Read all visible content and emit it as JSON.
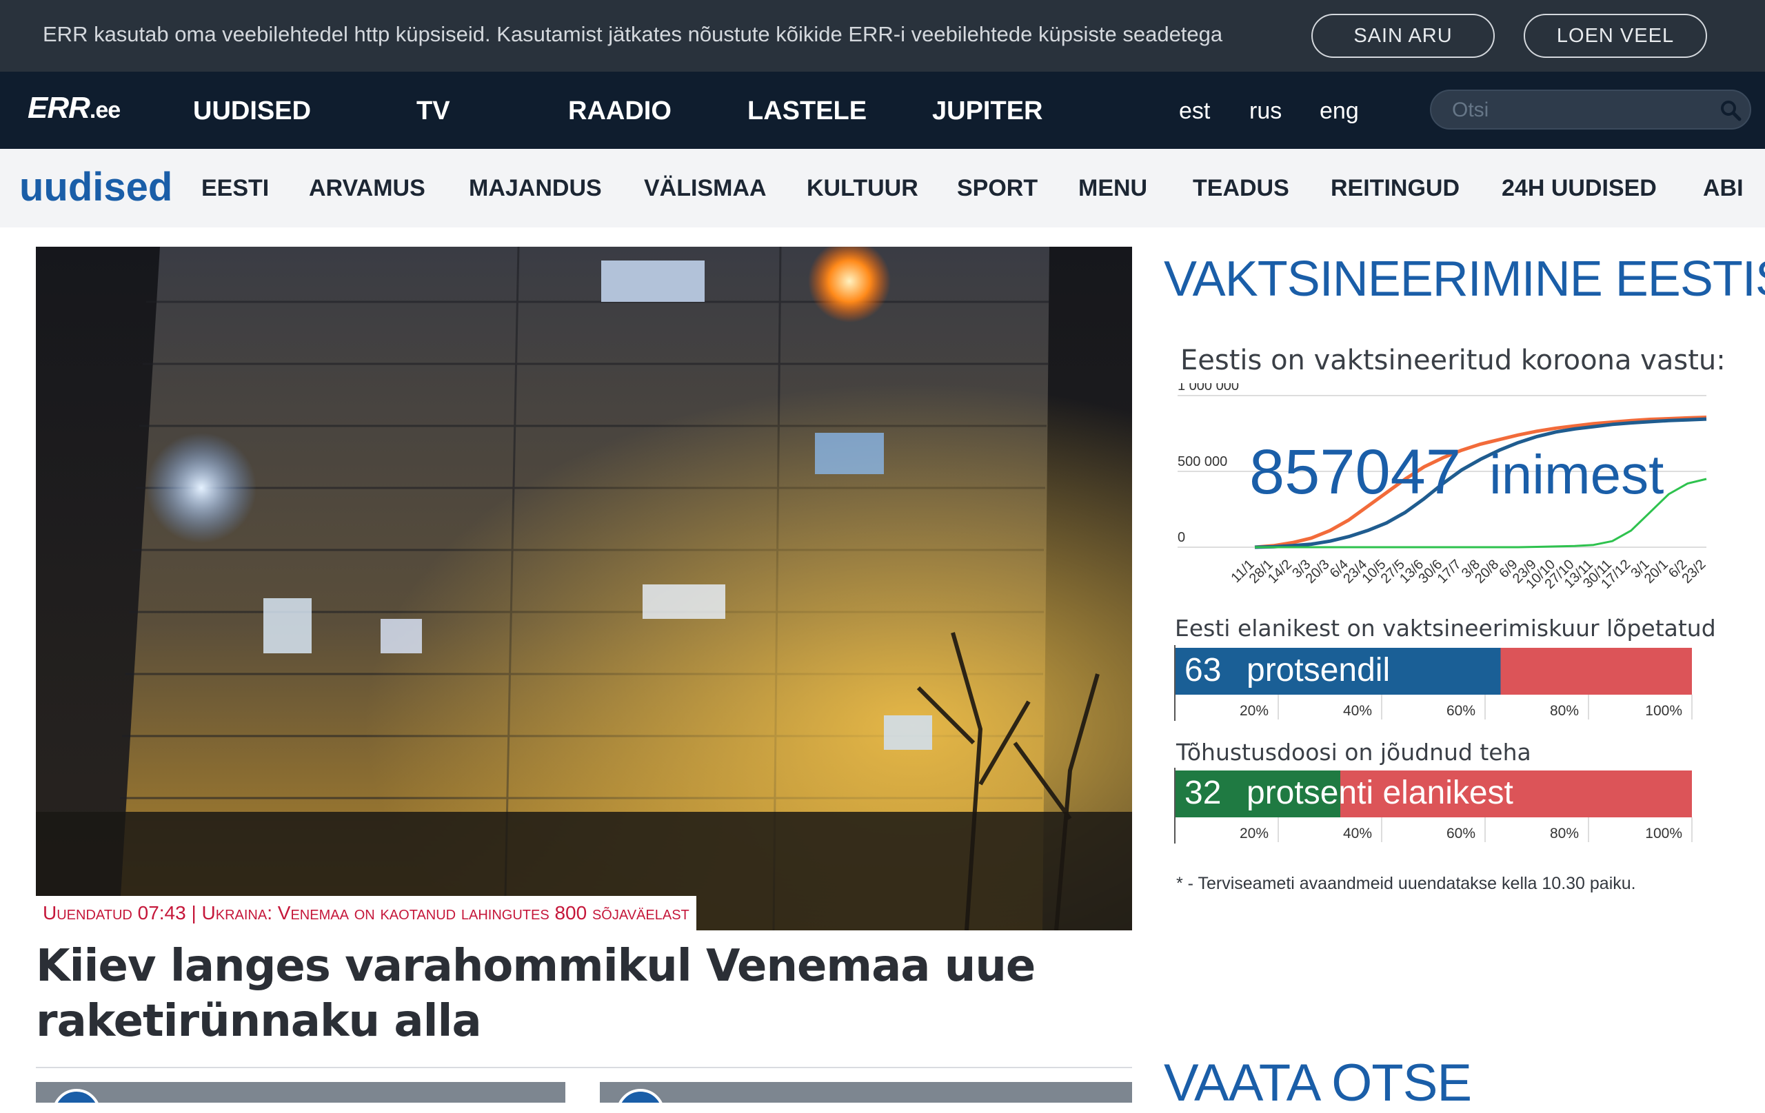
{
  "cookie": {
    "message": "ERR kasutab oma veebilehtedel http küpsiseid. Kasutamist jätkates nõustute kõikide ERR-i veebilehtede küpsiste seadetega",
    "accept_label": "SAIN ARU",
    "more_label": "LOEN VEEL"
  },
  "topnav": {
    "logo": "ERR",
    "logo_suffix": ".ee",
    "items": [
      "UUDISED",
      "TV",
      "RAADIO",
      "LASTELE",
      "JUPITER"
    ],
    "languages": [
      "est",
      "rus",
      "eng"
    ],
    "search_placeholder": "Otsi"
  },
  "subnav": {
    "brand": "uudised",
    "items": [
      "EESTI",
      "ARVAMUS",
      "MAJANDUS",
      "VÄLISMAA",
      "KULTUUR",
      "SPORT",
      "MENU",
      "TEADUS",
      "REITINGUD",
      "24H UUDISED",
      "ABI"
    ]
  },
  "hero": {
    "tag": "Uuendatud 07:43 | Ukraina: Venemaa on kaotanud lahingutes 800 sõjaväelast",
    "headline": "Kiiev langes varahommikul Venemaa uue raketirünnaku alla"
  },
  "sidebar": {
    "title": "VAKTSINEERIMINE EESTIS",
    "subtitle": "Eestis on vaktsineeritud koroona vastu:",
    "big_number": "857047",
    "big_unit": "inimest",
    "bar1_label": "Eesti elanikest on vaktsineerimiskuur lõpetatud",
    "bar1_value": "63",
    "bar1_unit": "protsendil",
    "bar2_label": "Tõhustusdoosi on jõudnud teha",
    "bar2_value": "32",
    "bar2_unit": "protsenti elanikest",
    "footnote": "* - Terviseameti avaandmeid uuendatakse kella 10.30 paiku.",
    "watch_title": "VAATA OTSE"
  },
  "chart_data": [
    {
      "type": "line",
      "ytick_labels": [
        "1 000 000",
        "500 000",
        "0"
      ],
      "ylim": [
        0,
        1000000
      ],
      "x_labels": [
        "11/1",
        "28/1",
        "14/2",
        "3/3",
        "20/3",
        "6/4",
        "23/4",
        "10/5",
        "27/5",
        "13/6",
        "30/6",
        "17/7",
        "3/8",
        "20/8",
        "6/9",
        "23/9",
        "10/10",
        "27/10",
        "13/11",
        "30/11",
        "17/12",
        "3/1",
        "20/1",
        "6/2",
        "23/2"
      ],
      "series": [
        {
          "color": "#f26b3a",
          "values": [
            0,
            10000,
            30000,
            60000,
            110000,
            180000,
            270000,
            360000,
            450000,
            530000,
            590000,
            640000,
            680000,
            710000,
            740000,
            765000,
            785000,
            800000,
            815000,
            825000,
            835000,
            843000,
            848000,
            853000,
            857000
          ]
        },
        {
          "color": "#1f5c8f",
          "values": [
            0,
            3000,
            10000,
            20000,
            40000,
            70000,
            110000,
            160000,
            230000,
            320000,
            420000,
            510000,
            580000,
            640000,
            690000,
            730000,
            760000,
            780000,
            795000,
            810000,
            820000,
            828000,
            835000,
            840000,
            845000
          ]
        },
        {
          "color": "#2ec24e",
          "values": [
            0,
            0,
            0,
            0,
            0,
            0,
            0,
            0,
            0,
            0,
            0,
            0,
            0,
            0,
            0,
            2000,
            5000,
            8000,
            15000,
            40000,
            110000,
            230000,
            350000,
            420000,
            450000
          ]
        }
      ]
    },
    {
      "type": "bar",
      "orientation": "horizontal",
      "values": [
        63
      ],
      "xlim": [
        0,
        100
      ],
      "tick_labels": [
        "20%",
        "40%",
        "60%",
        "80%",
        "100%"
      ],
      "fill_color": "#1a5f96",
      "rest_color": "#dc5458"
    },
    {
      "type": "bar",
      "orientation": "horizontal",
      "values": [
        32
      ],
      "xlim": [
        0,
        100
      ],
      "tick_labels": [
        "20%",
        "40%",
        "60%",
        "80%",
        "100%"
      ],
      "fill_color": "#1f7a42",
      "rest_color": "#dc5458"
    }
  ]
}
